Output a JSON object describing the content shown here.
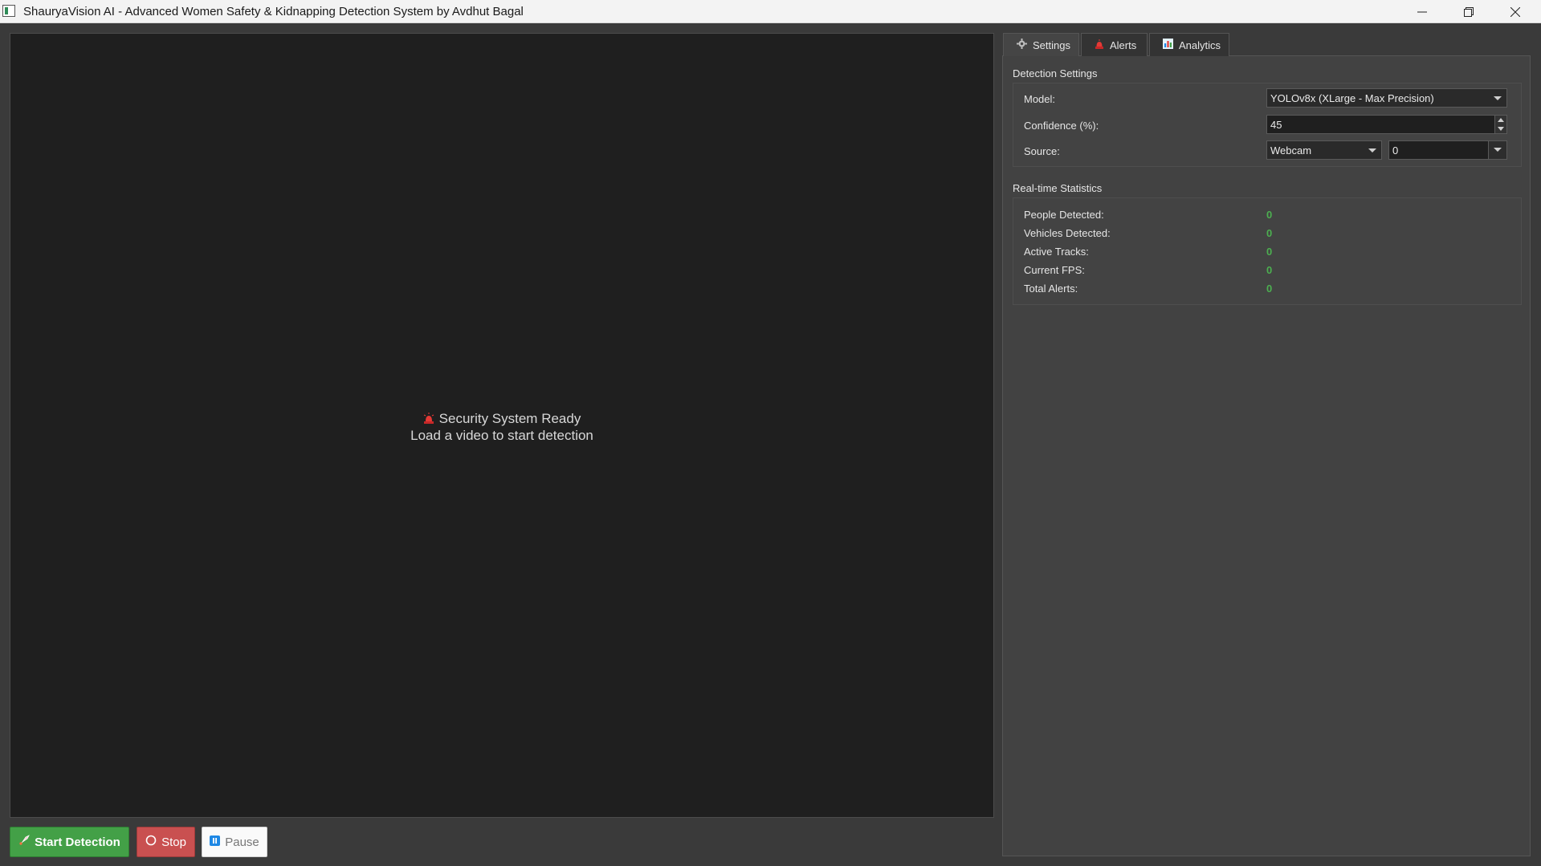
{
  "window": {
    "title": "ShauryaVision AI - Advanced Women Safety & Kidnapping Detection System by Avdhut Bagal"
  },
  "video": {
    "status_line1": "Security System Ready",
    "status_line2": "Load a video to start detection"
  },
  "controls": {
    "start_label": "Start Detection",
    "stop_label": "Stop",
    "pause_label": "Pause"
  },
  "tabs": [
    {
      "label": "Settings",
      "icon": "gear-icon",
      "active": true
    },
    {
      "label": "Alerts",
      "icon": "siren-icon",
      "active": false
    },
    {
      "label": "Analytics",
      "icon": "bar-chart-icon",
      "active": false
    }
  ],
  "detection_settings": {
    "title": "Detection Settings",
    "model_label": "Model:",
    "model_value": "YOLOv8x (XLarge - Max Precision)",
    "confidence_label": "Confidence (%):",
    "confidence_value": "45",
    "source_label": "Source:",
    "source_value": "Webcam",
    "source_index": "0"
  },
  "stats": {
    "title": "Real-time Statistics",
    "items": [
      {
        "label": "People Detected:",
        "value": "0"
      },
      {
        "label": "Vehicles Detected:",
        "value": "0"
      },
      {
        "label": "Active Tracks:",
        "value": "0"
      },
      {
        "label": "Current FPS:",
        "value": "0"
      },
      {
        "label": "Total Alerts:",
        "value": "0"
      }
    ]
  },
  "colors": {
    "start": "#43a047",
    "stop": "#c95050",
    "stat_value": "#4caf50",
    "video_bg": "#1f1f1f",
    "panel_bg": "#424242"
  }
}
